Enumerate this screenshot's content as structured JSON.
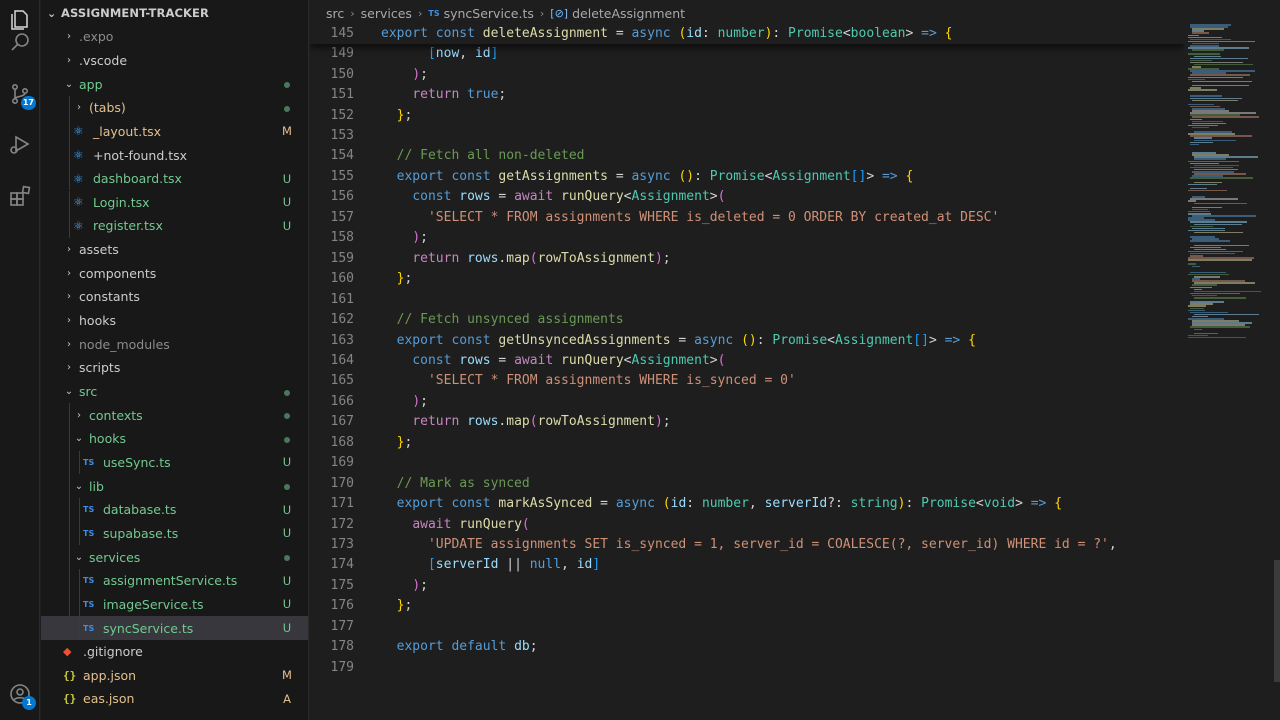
{
  "activity_bar": {
    "source_control_badge": "17",
    "account_badge": "1"
  },
  "explorer": {
    "title": "ASSIGNMENT-TRACKER",
    "items": [
      {
        "label": ".expo",
        "kind": "folder",
        "open": false,
        "depth": 0,
        "status": "",
        "color": "dim"
      },
      {
        "label": ".vscode",
        "kind": "folder",
        "open": false,
        "depth": 0,
        "status": "",
        "color": "plain"
      },
      {
        "label": "app",
        "kind": "folder",
        "open": true,
        "depth": 0,
        "status": "dot",
        "color": "green"
      },
      {
        "label": "(tabs)",
        "kind": "folder",
        "open": false,
        "depth": 1,
        "status": "dot",
        "color": "yellow"
      },
      {
        "label": "_layout.tsx",
        "kind": "react",
        "depth": 1,
        "status": "M",
        "color": "yellow"
      },
      {
        "label": "+not-found.tsx",
        "kind": "react",
        "depth": 1,
        "status": "",
        "color": "plain"
      },
      {
        "label": "dashboard.tsx",
        "kind": "react",
        "depth": 1,
        "status": "U",
        "color": "green"
      },
      {
        "label": "Login.tsx",
        "kind": "react",
        "depth": 1,
        "status": "U",
        "color": "green"
      },
      {
        "label": "register.tsx",
        "kind": "react",
        "depth": 1,
        "status": "U",
        "color": "green"
      },
      {
        "label": "assets",
        "kind": "folder",
        "open": false,
        "depth": 0,
        "status": "",
        "color": "plain"
      },
      {
        "label": "components",
        "kind": "folder",
        "open": false,
        "depth": 0,
        "status": "",
        "color": "plain"
      },
      {
        "label": "constants",
        "kind": "folder",
        "open": false,
        "depth": 0,
        "status": "",
        "color": "plain"
      },
      {
        "label": "hooks",
        "kind": "folder",
        "open": false,
        "depth": 0,
        "status": "",
        "color": "plain"
      },
      {
        "label": "node_modules",
        "kind": "folder",
        "open": false,
        "depth": 0,
        "status": "",
        "color": "dim"
      },
      {
        "label": "scripts",
        "kind": "folder",
        "open": false,
        "depth": 0,
        "status": "",
        "color": "plain"
      },
      {
        "label": "src",
        "kind": "folder",
        "open": true,
        "depth": 0,
        "status": "dot",
        "color": "green"
      },
      {
        "label": "contexts",
        "kind": "folder",
        "open": false,
        "depth": 1,
        "status": "dot",
        "color": "green"
      },
      {
        "label": "hooks",
        "kind": "folder",
        "open": true,
        "depth": 1,
        "status": "dot",
        "color": "green"
      },
      {
        "label": "useSync.ts",
        "kind": "ts",
        "depth": 2,
        "status": "U",
        "color": "green"
      },
      {
        "label": "lib",
        "kind": "folder",
        "open": true,
        "depth": 1,
        "status": "dot",
        "color": "green"
      },
      {
        "label": "database.ts",
        "kind": "ts",
        "depth": 2,
        "status": "U",
        "color": "green"
      },
      {
        "label": "supabase.ts",
        "kind": "ts",
        "depth": 2,
        "status": "U",
        "color": "green"
      },
      {
        "label": "services",
        "kind": "folder",
        "open": true,
        "depth": 1,
        "status": "dot",
        "color": "green"
      },
      {
        "label": "assignmentService.ts",
        "kind": "ts",
        "depth": 2,
        "status": "U",
        "color": "green"
      },
      {
        "label": "imageService.ts",
        "kind": "ts",
        "depth": 2,
        "status": "U",
        "color": "green"
      },
      {
        "label": "syncService.ts",
        "kind": "ts",
        "depth": 2,
        "status": "U",
        "color": "green",
        "selected": true
      },
      {
        "label": ".gitignore",
        "kind": "git",
        "depth": 0,
        "status": "",
        "color": "plain"
      },
      {
        "label": "app.json",
        "kind": "json",
        "depth": 0,
        "status": "M",
        "color": "yellow"
      },
      {
        "label": "eas.json",
        "kind": "json",
        "depth": 0,
        "status": "A",
        "color": "yellow"
      }
    ]
  },
  "breadcrumb": {
    "parts": [
      "src",
      "services",
      "syncService.ts",
      "deleteAssignment"
    ]
  },
  "editor": {
    "lines": [
      {
        "n": "145",
        "sticky": true,
        "tokens": [
          [
            "kw",
            "export"
          ],
          [
            "pun",
            " "
          ],
          [
            "kw",
            "const"
          ],
          [
            "pun",
            " "
          ],
          [
            "fn",
            "deleteAssignment"
          ],
          [
            "pun",
            " = "
          ],
          [
            "kw",
            "async"
          ],
          [
            "pun",
            " "
          ],
          [
            "br1",
            "("
          ],
          [
            "var",
            "id"
          ],
          [
            "pun",
            ": "
          ],
          [
            "type",
            "number"
          ],
          [
            "br1",
            ")"
          ],
          [
            "pun",
            ": "
          ],
          [
            "type",
            "Promise"
          ],
          [
            "pun",
            "<"
          ],
          [
            "type",
            "boolean"
          ],
          [
            "pun",
            "> "
          ],
          [
            "kw",
            "=>"
          ],
          [
            "pun",
            " "
          ],
          [
            "br1",
            "{"
          ]
        ]
      },
      {
        "n": "149",
        "tokens": [
          [
            "pun",
            "      "
          ],
          [
            "br3",
            "["
          ],
          [
            "var",
            "now"
          ],
          [
            "pun",
            ", "
          ],
          [
            "var",
            "id"
          ],
          [
            "br3",
            "]"
          ]
        ]
      },
      {
        "n": "150",
        "tokens": [
          [
            "pun",
            "    "
          ],
          [
            "br2",
            ")"
          ],
          [
            "pun",
            ";"
          ]
        ]
      },
      {
        "n": "151",
        "tokens": [
          [
            "pun",
            "    "
          ],
          [
            "kw2",
            "return"
          ],
          [
            "pun",
            " "
          ],
          [
            "kw",
            "true"
          ],
          [
            "pun",
            ";"
          ]
        ]
      },
      {
        "n": "152",
        "tokens": [
          [
            "pun",
            "  "
          ],
          [
            "br1",
            "}"
          ],
          [
            "pun",
            ";"
          ]
        ]
      },
      {
        "n": "153",
        "tokens": []
      },
      {
        "n": "154",
        "tokens": [
          [
            "pun",
            "  "
          ],
          [
            "com",
            "// Fetch all non-deleted"
          ]
        ]
      },
      {
        "n": "155",
        "tokens": [
          [
            "pun",
            "  "
          ],
          [
            "kw",
            "export"
          ],
          [
            "pun",
            " "
          ],
          [
            "kw",
            "const"
          ],
          [
            "pun",
            " "
          ],
          [
            "fn",
            "getAssignments"
          ],
          [
            "pun",
            " = "
          ],
          [
            "kw",
            "async"
          ],
          [
            "pun",
            " "
          ],
          [
            "br1",
            "()"
          ],
          [
            "pun",
            ": "
          ],
          [
            "type",
            "Promise"
          ],
          [
            "pun",
            "<"
          ],
          [
            "type",
            "Assignment"
          ],
          [
            "br3",
            "[]"
          ],
          [
            "pun",
            "> "
          ],
          [
            "kw",
            "=>"
          ],
          [
            "pun",
            " "
          ],
          [
            "br1",
            "{"
          ]
        ]
      },
      {
        "n": "156",
        "tokens": [
          [
            "pun",
            "    "
          ],
          [
            "kw",
            "const"
          ],
          [
            "pun",
            " "
          ],
          [
            "var",
            "rows"
          ],
          [
            "pun",
            " = "
          ],
          [
            "kw2",
            "await"
          ],
          [
            "pun",
            " "
          ],
          [
            "fn",
            "runQuery"
          ],
          [
            "pun",
            "<"
          ],
          [
            "type",
            "Assignment"
          ],
          [
            "pun",
            ">"
          ],
          [
            "br2",
            "("
          ]
        ]
      },
      {
        "n": "157",
        "tokens": [
          [
            "pun",
            "      "
          ],
          [
            "str",
            "'SELECT * FROM assignments WHERE is_deleted = 0 ORDER BY created_at DESC'"
          ]
        ]
      },
      {
        "n": "158",
        "tokens": [
          [
            "pun",
            "    "
          ],
          [
            "br2",
            ")"
          ],
          [
            "pun",
            ";"
          ]
        ]
      },
      {
        "n": "159",
        "tokens": [
          [
            "pun",
            "    "
          ],
          [
            "kw2",
            "return"
          ],
          [
            "pun",
            " "
          ],
          [
            "var",
            "rows"
          ],
          [
            "pun",
            "."
          ],
          [
            "fn",
            "map"
          ],
          [
            "br2",
            "("
          ],
          [
            "fn",
            "rowToAssignment"
          ],
          [
            "br2",
            ")"
          ],
          [
            "pun",
            ";"
          ]
        ]
      },
      {
        "n": "160",
        "tokens": [
          [
            "pun",
            "  "
          ],
          [
            "br1",
            "}"
          ],
          [
            "pun",
            ";"
          ]
        ]
      },
      {
        "n": "161",
        "tokens": []
      },
      {
        "n": "162",
        "tokens": [
          [
            "pun",
            "  "
          ],
          [
            "com",
            "// Fetch unsynced assignments"
          ]
        ]
      },
      {
        "n": "163",
        "tokens": [
          [
            "pun",
            "  "
          ],
          [
            "kw",
            "export"
          ],
          [
            "pun",
            " "
          ],
          [
            "kw",
            "const"
          ],
          [
            "pun",
            " "
          ],
          [
            "fn",
            "getUnsyncedAssignments"
          ],
          [
            "pun",
            " = "
          ],
          [
            "kw",
            "async"
          ],
          [
            "pun",
            " "
          ],
          [
            "br1",
            "()"
          ],
          [
            "pun",
            ": "
          ],
          [
            "type",
            "Promise"
          ],
          [
            "pun",
            "<"
          ],
          [
            "type",
            "Assignment"
          ],
          [
            "br3",
            "[]"
          ],
          [
            "pun",
            "> "
          ],
          [
            "kw",
            "=>"
          ],
          [
            "pun",
            " "
          ],
          [
            "br1",
            "{"
          ]
        ]
      },
      {
        "n": "164",
        "tokens": [
          [
            "pun",
            "    "
          ],
          [
            "kw",
            "const"
          ],
          [
            "pun",
            " "
          ],
          [
            "var",
            "rows"
          ],
          [
            "pun",
            " = "
          ],
          [
            "kw2",
            "await"
          ],
          [
            "pun",
            " "
          ],
          [
            "fn",
            "runQuery"
          ],
          [
            "pun",
            "<"
          ],
          [
            "type",
            "Assignment"
          ],
          [
            "pun",
            ">"
          ],
          [
            "br2",
            "("
          ]
        ]
      },
      {
        "n": "165",
        "tokens": [
          [
            "pun",
            "      "
          ],
          [
            "str",
            "'SELECT * FROM assignments WHERE is_synced = 0'"
          ]
        ]
      },
      {
        "n": "166",
        "tokens": [
          [
            "pun",
            "    "
          ],
          [
            "br2",
            ")"
          ],
          [
            "pun",
            ";"
          ]
        ]
      },
      {
        "n": "167",
        "tokens": [
          [
            "pun",
            "    "
          ],
          [
            "kw2",
            "return"
          ],
          [
            "pun",
            " "
          ],
          [
            "var",
            "rows"
          ],
          [
            "pun",
            "."
          ],
          [
            "fn",
            "map"
          ],
          [
            "br2",
            "("
          ],
          [
            "fn",
            "rowToAssignment"
          ],
          [
            "br2",
            ")"
          ],
          [
            "pun",
            ";"
          ]
        ]
      },
      {
        "n": "168",
        "tokens": [
          [
            "pun",
            "  "
          ],
          [
            "br1",
            "}"
          ],
          [
            "pun",
            ";"
          ]
        ]
      },
      {
        "n": "169",
        "tokens": []
      },
      {
        "n": "170",
        "tokens": [
          [
            "pun",
            "  "
          ],
          [
            "com",
            "// Mark as synced"
          ]
        ]
      },
      {
        "n": "171",
        "tokens": [
          [
            "pun",
            "  "
          ],
          [
            "kw",
            "export"
          ],
          [
            "pun",
            " "
          ],
          [
            "kw",
            "const"
          ],
          [
            "pun",
            " "
          ],
          [
            "fn",
            "markAsSynced"
          ],
          [
            "pun",
            " = "
          ],
          [
            "kw",
            "async"
          ],
          [
            "pun",
            " "
          ],
          [
            "br1",
            "("
          ],
          [
            "var",
            "id"
          ],
          [
            "pun",
            ": "
          ],
          [
            "type",
            "number"
          ],
          [
            "pun",
            ", "
          ],
          [
            "var",
            "serverId"
          ],
          [
            "pun",
            "?: "
          ],
          [
            "type",
            "string"
          ],
          [
            "br1",
            ")"
          ],
          [
            "pun",
            ": "
          ],
          [
            "type",
            "Promise"
          ],
          [
            "pun",
            "<"
          ],
          [
            "type",
            "void"
          ],
          [
            "pun",
            "> "
          ],
          [
            "kw",
            "=>"
          ],
          [
            "pun",
            " "
          ],
          [
            "br1",
            "{"
          ]
        ]
      },
      {
        "n": "172",
        "tokens": [
          [
            "pun",
            "    "
          ],
          [
            "kw2",
            "await"
          ],
          [
            "pun",
            " "
          ],
          [
            "fn",
            "runQuery"
          ],
          [
            "br2",
            "("
          ]
        ]
      },
      {
        "n": "173",
        "tokens": [
          [
            "pun",
            "      "
          ],
          [
            "str",
            "'UPDATE assignments SET is_synced = 1, server_id = COALESCE(?, server_id) WHERE id = ?'"
          ],
          [
            "pun",
            ","
          ]
        ]
      },
      {
        "n": "174",
        "tokens": [
          [
            "pun",
            "      "
          ],
          [
            "br3",
            "["
          ],
          [
            "var",
            "serverId"
          ],
          [
            "pun",
            " || "
          ],
          [
            "kw",
            "null"
          ],
          [
            "pun",
            ", "
          ],
          [
            "var",
            "id"
          ],
          [
            "br3",
            "]"
          ]
        ]
      },
      {
        "n": "175",
        "tokens": [
          [
            "pun",
            "    "
          ],
          [
            "br2",
            ")"
          ],
          [
            "pun",
            ";"
          ]
        ]
      },
      {
        "n": "176",
        "tokens": [
          [
            "pun",
            "  "
          ],
          [
            "br1",
            "}"
          ],
          [
            "pun",
            ";"
          ]
        ]
      },
      {
        "n": "177",
        "tokens": []
      },
      {
        "n": "178",
        "tokens": [
          [
            "pun",
            "  "
          ],
          [
            "kw",
            "export"
          ],
          [
            "pun",
            " "
          ],
          [
            "kw",
            "default"
          ],
          [
            "pun",
            " "
          ],
          [
            "var",
            "db"
          ],
          [
            "pun",
            ";"
          ]
        ]
      },
      {
        "n": "179",
        "tokens": []
      }
    ]
  }
}
